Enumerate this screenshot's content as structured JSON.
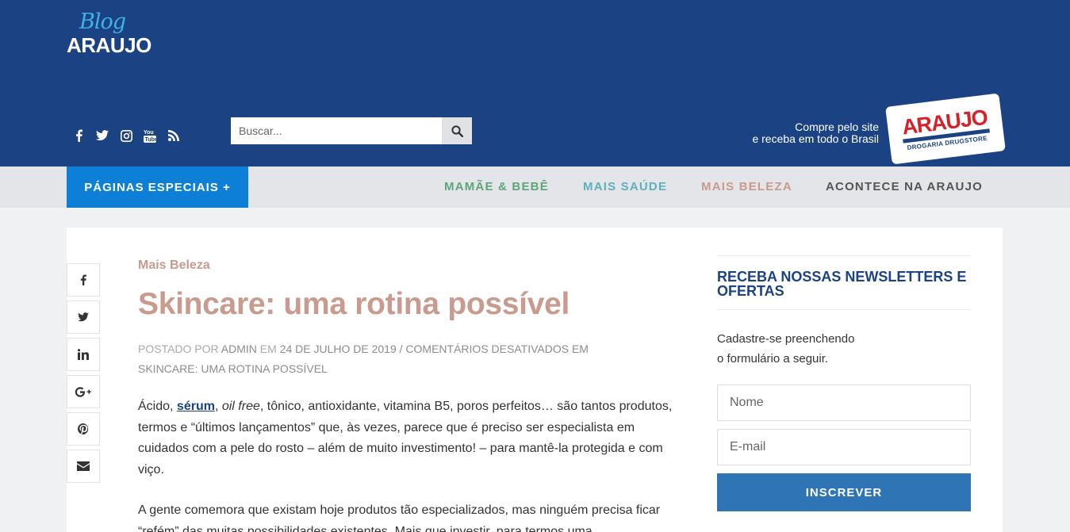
{
  "header": {
    "logo_blog": "Blog",
    "logo_name": "ARAUJO",
    "social_icons": [
      "facebook-icon",
      "twitter-icon",
      "instagram-icon",
      "youtube-icon",
      "rss-icon"
    ],
    "search": {
      "placeholder": "Buscar..."
    },
    "promo_line1": "Compre pelo site",
    "promo_line2": "e receba em todo o Brasil",
    "store_logo_name": "ARAUJO",
    "store_logo_sub": "DROGARIA DRUGSTORE"
  },
  "nav": {
    "special": "PÁGINAS ESPECIAIS +",
    "links": [
      "MAMÃE & BEBÊ",
      "MAIS SAÚDE",
      "MAIS BELEZA",
      "ACONTECE NA ARAUJO"
    ],
    "colors": {
      "mamae": "#5fa47a",
      "saude": "#5fb0bd",
      "beleza": "#c99a8e",
      "acontece": "#555555"
    }
  },
  "article": {
    "category": "Mais Beleza",
    "title": "Skincare: uma rotina possível",
    "meta": {
      "posted_by": "POSTADO POR",
      "author": "ADMIN",
      "on": "EM",
      "date": "24 DE JULHO DE 2019",
      "comments": "/ COMENTÁRIOS DESATIVADOS EM",
      "comments_target": "SKINCARE: UMA ROTINA POSSÍVEL"
    },
    "p1_start": "Ácido, ",
    "p1_link": "sérum",
    "p1_sep": ", ",
    "p1_italic": "oil free",
    "p1_rest": ", tônico, antioxidante, vitamina B5, poros perfeitos… são tantos produtos, termos e “últimos lançamentos” que, às vezes, parece que é preciso ser especialista em cuidados com a pele do rosto – além de muito investimento! – para mantê-la protegida e com viço.",
    "p2": "A gente comemora que existam hoje produtos tão especializados, mas ninguém precisa ficar “refém” das muitas possibilidades existentes. Mais que investir, para termos uma"
  },
  "share": [
    "facebook-icon",
    "twitter-icon",
    "linkedin-icon",
    "google-plus-icon",
    "pinterest-icon",
    "email-icon"
  ],
  "sidebar": {
    "newsletter_title": "RECEBA NOSSAS NEWSLETTERS E OFERTAS",
    "newsletter_text_1": "Cadastre-se preenchendo",
    "newsletter_text_2": "o formulário a seguir.",
    "name_placeholder": "Nome",
    "email_placeholder": "E-mail",
    "submit_label": "INSCREVER"
  }
}
